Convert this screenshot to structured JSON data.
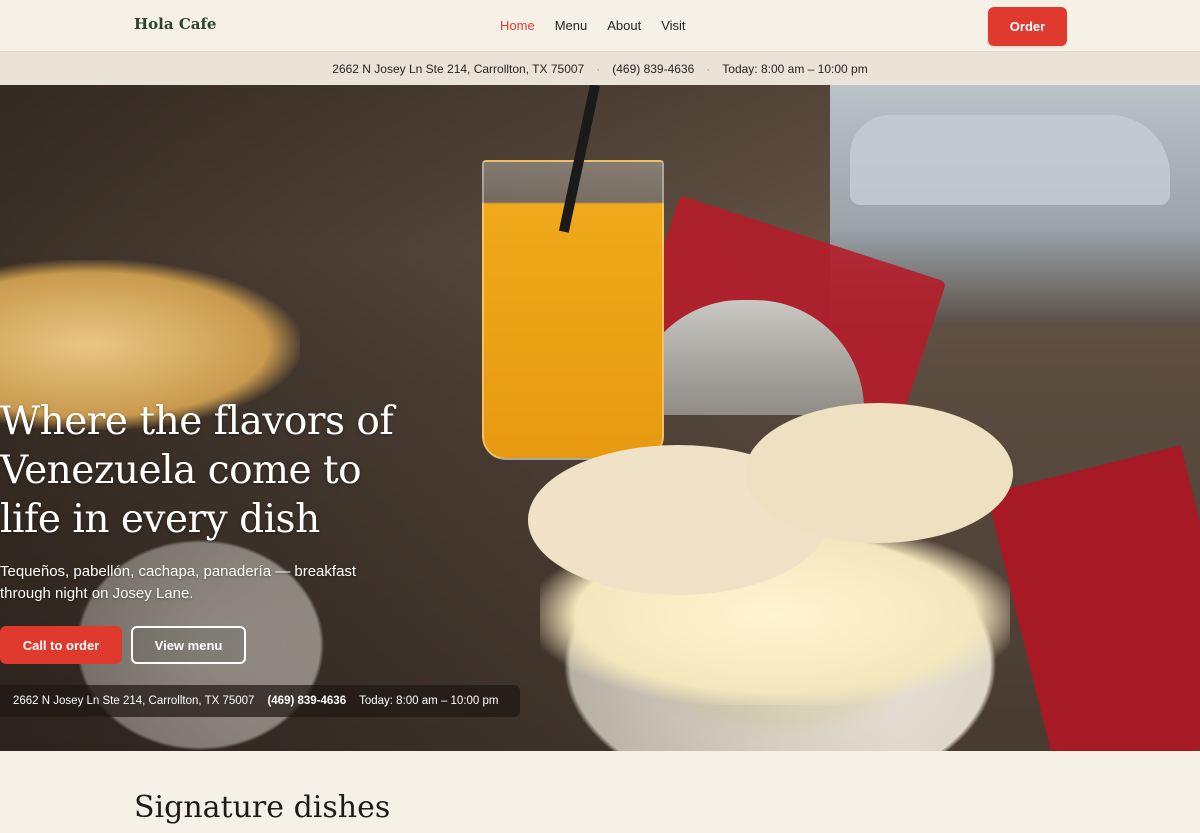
{
  "header": {
    "brand": "Hola Cafe",
    "nav": [
      {
        "label": "Home",
        "active": true
      },
      {
        "label": "Menu",
        "active": false
      },
      {
        "label": "About",
        "active": false
      },
      {
        "label": "Visit",
        "active": false
      }
    ],
    "order_label": "Order"
  },
  "infobar": {
    "address": "2662 N Josey Ln Ste 214, Carrollton, TX 75007",
    "separator": "·",
    "phone": "(469) 839-4636",
    "hours": "Today: 8:00 am – 10:00 pm"
  },
  "hero": {
    "title": "Where the flavors of Venezuela come to life in every dish",
    "subtitle": "Tequeños, pabellón, cachapa, panadería — breakfast through night on Josey Lane.",
    "call_label": "Call to order",
    "menu_label": "View menu",
    "chip": {
      "address": "2662 N Josey Ln Ste 214, Carrollton, TX 75007",
      "phone": "(469) 839-4636",
      "hours": "Today: 8:00 am – 10:00 pm"
    }
  },
  "section": {
    "title": "Signature dishes"
  },
  "colors": {
    "accent": "#e03a2f",
    "background": "#f6f1e7",
    "brand": "#2d4430"
  }
}
